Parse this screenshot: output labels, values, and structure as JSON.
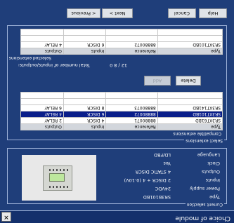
{
  "window": {
    "title": "Choice of module",
    "close_glyph": "✕"
  },
  "current_selection": {
    "label": "Current selection",
    "properties": [
      {
        "key": "Type",
        "value": "SR3B101BD"
      },
      {
        "key": "Power supply",
        "value": "24VDC"
      },
      {
        "key": "Inputs",
        "value": "2 DISCR + 4 (0-10V)"
      },
      {
        "key": "Outputs",
        "value": "4 STATIC DISCR"
      },
      {
        "key": "Clock",
        "value": "Yes"
      },
      {
        "key": "Language",
        "value": "LD/FBD"
      }
    ]
  },
  "select_extensions": {
    "label": "Select extensions",
    "compatible_label": "Compatible extensions",
    "columns": [
      "Type",
      "Reference",
      "Inputs",
      "Outputs"
    ],
    "rows": [
      {
        "type": "SR3XT61BD",
        "reference": "88880071",
        "inputs": "4 DISCR",
        "outputs": "2 RELAY"
      },
      {
        "type": "SR3XT101BD",
        "reference": "88880072",
        "inputs": "6 DISCR",
        "outputs": "4 RELAY"
      },
      {
        "type": "SR3XT141BD",
        "reference": "88880073",
        "inputs": "8 DISCR",
        "outputs": "6 RELAY"
      }
    ],
    "selected_row": 1,
    "add_label": "Add",
    "delete_label": "Delete",
    "total_io_label": "Total number of inputs/outputs:",
    "total_io_value": "12 / 8 0",
    "selected_label": "Selected extensions",
    "selected_rows": [
      {
        "type": "SR3XT101BD",
        "reference": "88880072",
        "inputs": "6 DISCR",
        "outputs": "4 RELAY"
      }
    ]
  },
  "buttons": {
    "previous": "< Previous",
    "next": "Next >",
    "cancel": "Cancel",
    "help": "Help"
  }
}
